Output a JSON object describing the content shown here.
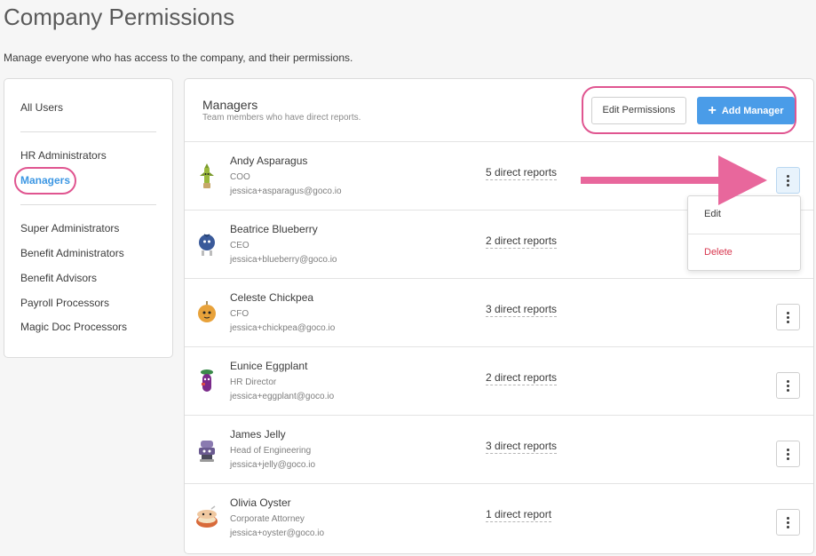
{
  "page": {
    "title": "Company Permissions",
    "subtitle": "Manage everyone who has access to the company, and their permissions."
  },
  "sidebar": {
    "items": [
      {
        "label": "All Users",
        "active": false
      },
      {
        "label": "HR Administrators",
        "active": false
      },
      {
        "label": "Managers",
        "active": true
      },
      {
        "label": "Super Administrators",
        "active": false
      },
      {
        "label": "Benefit Administrators",
        "active": false
      },
      {
        "label": "Benefit Advisors",
        "active": false
      },
      {
        "label": "Payroll Processors",
        "active": false
      },
      {
        "label": "Magic Doc Processors",
        "active": false
      }
    ]
  },
  "panel": {
    "title": "Managers",
    "subtitle": "Team members who have direct reports.",
    "edit_button": "Edit Permissions",
    "add_button": "Add Manager"
  },
  "managers": [
    {
      "name": "Andy Asparagus",
      "role": "COO",
      "email": "jessica+asparagus@goco.io",
      "reports": "5 direct reports",
      "avatar": "asparagus-avatar-icon"
    },
    {
      "name": "Beatrice Blueberry",
      "role": "CEO",
      "email": "jessica+blueberry@goco.io",
      "reports": "2 direct reports",
      "avatar": "blueberry-avatar-icon"
    },
    {
      "name": "Celeste Chickpea",
      "role": "CFO",
      "email": "jessica+chickpea@goco.io",
      "reports": "3 direct reports",
      "avatar": "chickpea-avatar-icon"
    },
    {
      "name": "Eunice Eggplant",
      "role": "HR Director",
      "email": "jessica+eggplant@goco.io",
      "reports": "2 direct reports",
      "avatar": "eggplant-avatar-icon"
    },
    {
      "name": "James Jelly",
      "role": "Head of Engineering",
      "email": "jessica+jelly@goco.io",
      "reports": "3 direct reports",
      "avatar": "jelly-avatar-icon"
    },
    {
      "name": "Olivia Oyster",
      "role": "Corporate Attorney",
      "email": "jessica+oyster@goco.io",
      "reports": "1 direct report",
      "avatar": "oyster-avatar-icon"
    }
  ],
  "dropdown": {
    "edit": "Edit",
    "delete": "Delete"
  },
  "colors": {
    "accent": "#4a9ce8",
    "highlight": "#e05590",
    "danger": "#d8374f"
  }
}
